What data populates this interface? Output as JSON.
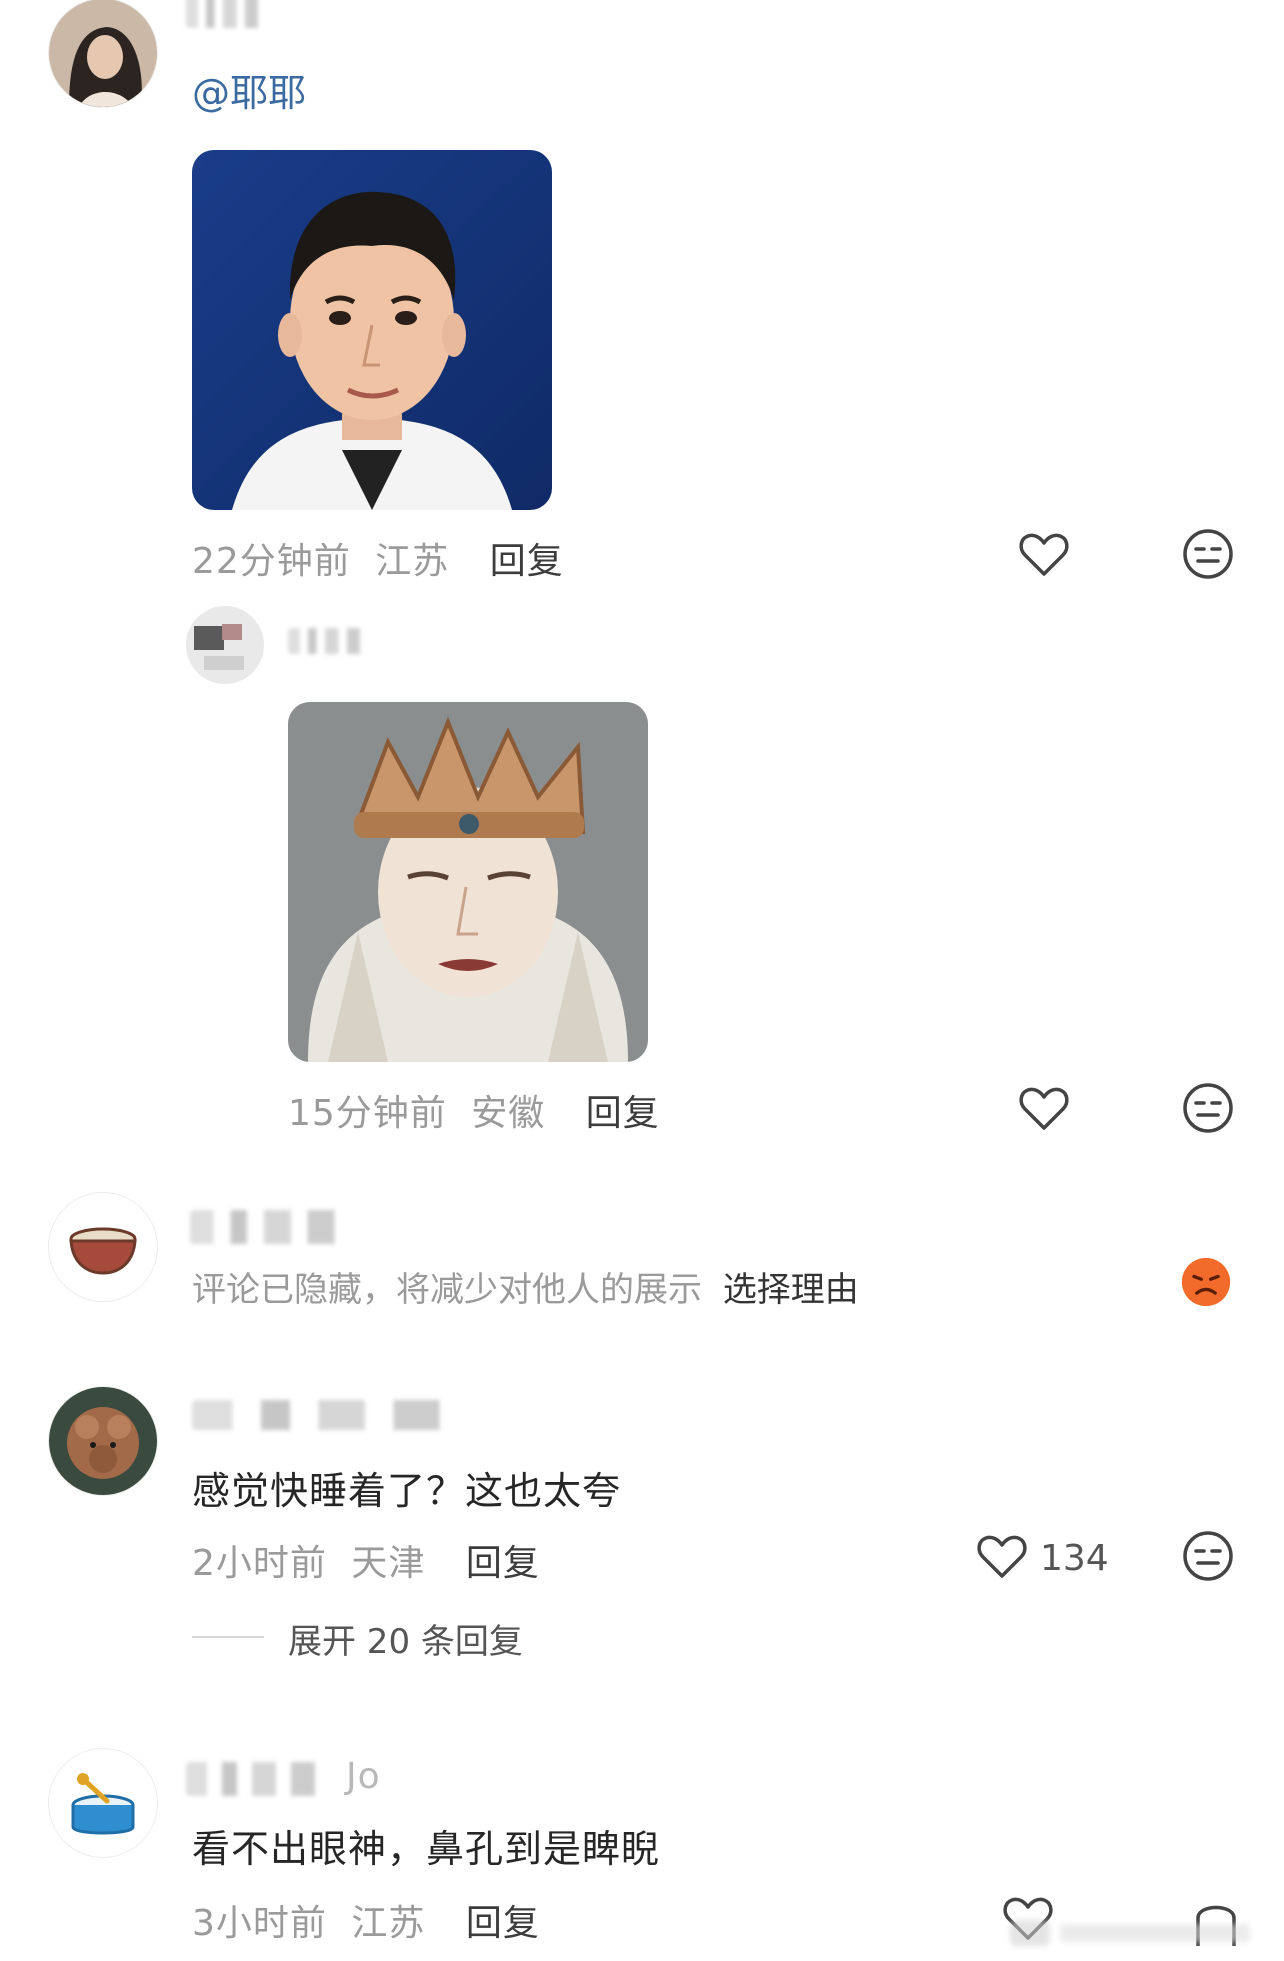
{
  "comments": [
    {
      "mention": "@耶耶",
      "time": "22分钟前",
      "location": "江苏",
      "reply_label": "回复"
    },
    {
      "time": "15分钟前",
      "location": "安徽",
      "reply_label": "回复"
    },
    {
      "hidden_text": "评论已隐藏，将减少对他人的展示",
      "hidden_action": "选择理由"
    },
    {
      "text": "感觉快睡着了？这也太夸",
      "time": "2小时前",
      "location": "天津",
      "reply_label": "回复",
      "likes": "134",
      "expand_label": "展开 20 条回复"
    },
    {
      "partial_name": "Jo",
      "text": "看不出眼神，鼻孔到是睥睨",
      "time": "3小时前",
      "location": "江苏",
      "reply_label": "回复"
    }
  ],
  "icons": {
    "like": "heart-icon",
    "dislike": "meh-face-icon",
    "dislike_active": "sad-face-icon"
  },
  "colors": {
    "mention": "#3b6aa0",
    "dislike_active": "#f26b2b"
  }
}
